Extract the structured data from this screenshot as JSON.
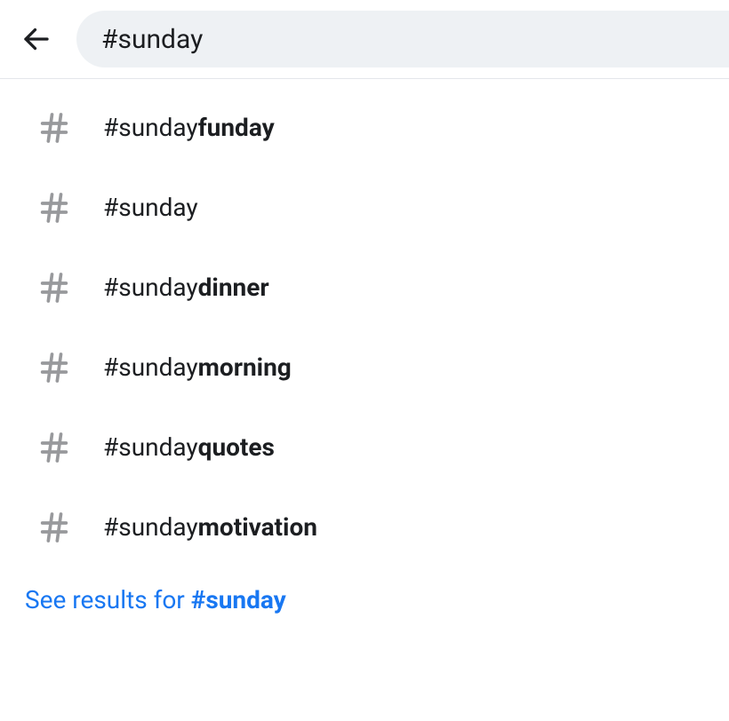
{
  "search": {
    "query": "#sunday"
  },
  "suggestions": [
    {
      "prefix": "#sunday",
      "suffix": "funday"
    },
    {
      "prefix": "#sunday",
      "suffix": ""
    },
    {
      "prefix": "#sunday",
      "suffix": "dinner"
    },
    {
      "prefix": "#sunday",
      "suffix": "morning"
    },
    {
      "prefix": "#sunday",
      "suffix": "quotes"
    },
    {
      "prefix": "#sunday",
      "suffix": "motivation"
    }
  ],
  "see_results": {
    "label_prefix": "See results for ",
    "query": "#sunday"
  }
}
